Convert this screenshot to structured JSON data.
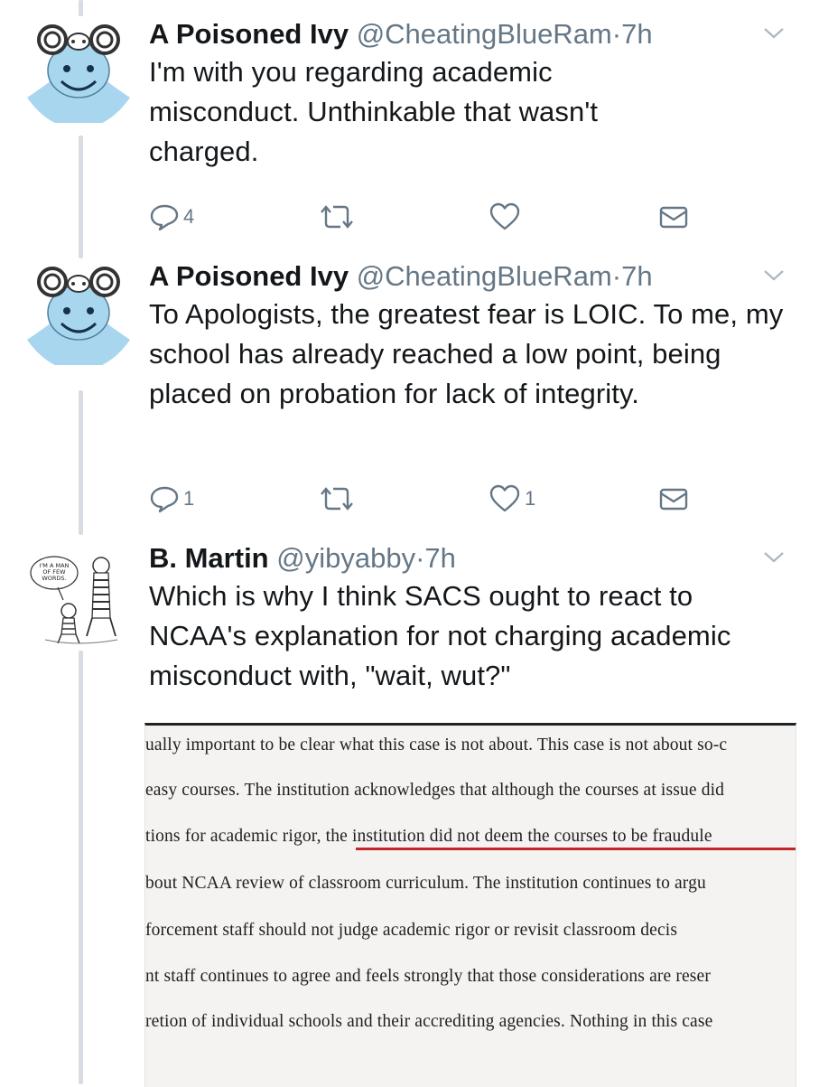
{
  "tweets": [
    {
      "name": "A Poisoned Ivy",
      "handle": "@CheatingBlueRam",
      "separator": "·",
      "time": "7h",
      "text": "I'm with you regarding academic misconduct. Unthinkable that wasn't charged.",
      "reply_count": "4",
      "retweet_count": "",
      "like_count": ""
    },
    {
      "name": "A Poisoned Ivy",
      "handle": "@CheatingBlueRam",
      "separator": "·",
      "time": "7h",
      "text": "To Apologists, the greatest fear is LOIC. To me, my school has already reached a low point, being placed on probation for lack of integrity.",
      "reply_count": "1",
      "retweet_count": "",
      "like_count": "1"
    },
    {
      "name": "B. Martin",
      "handle": "@yibyabby",
      "separator": "·",
      "time": "7h",
      "text": "Which is why I think SACS ought to react to NCAA's explanation for not charging academic misconduct with, \"wait, wut?\"",
      "reply_count": "",
      "retweet_count": "",
      "like_count": ""
    }
  ],
  "avatar_comic_text": "I'M A MAN OF FEW WORDS.",
  "document_lines": [
    "ually important to be clear what this case is not about. This case is not about so-c",
    "easy courses. The institution acknowledges that although the courses at issue did",
    "tions for academic rigor, the institution did not deem the courses to be fraudule",
    "bout NCAA review of classroom curriculum. The institution continues to argu",
    "forcement staff should not judge academic rigor or revisit classroom decis",
    "nt staff continues to agree and feels strongly that those considerations are reser",
    "retion of individual schools and their accrediting agencies. Nothing in this case"
  ],
  "colors": {
    "secondary_text": "#657786",
    "primary_text": "#14171a",
    "thread_line": "#d7dde2",
    "underline": "#c0262d",
    "avatar_blue": "#a9d6ef"
  },
  "icons": [
    "reply-icon",
    "retweet-icon",
    "like-icon",
    "message-icon",
    "chevron-down-icon"
  ]
}
